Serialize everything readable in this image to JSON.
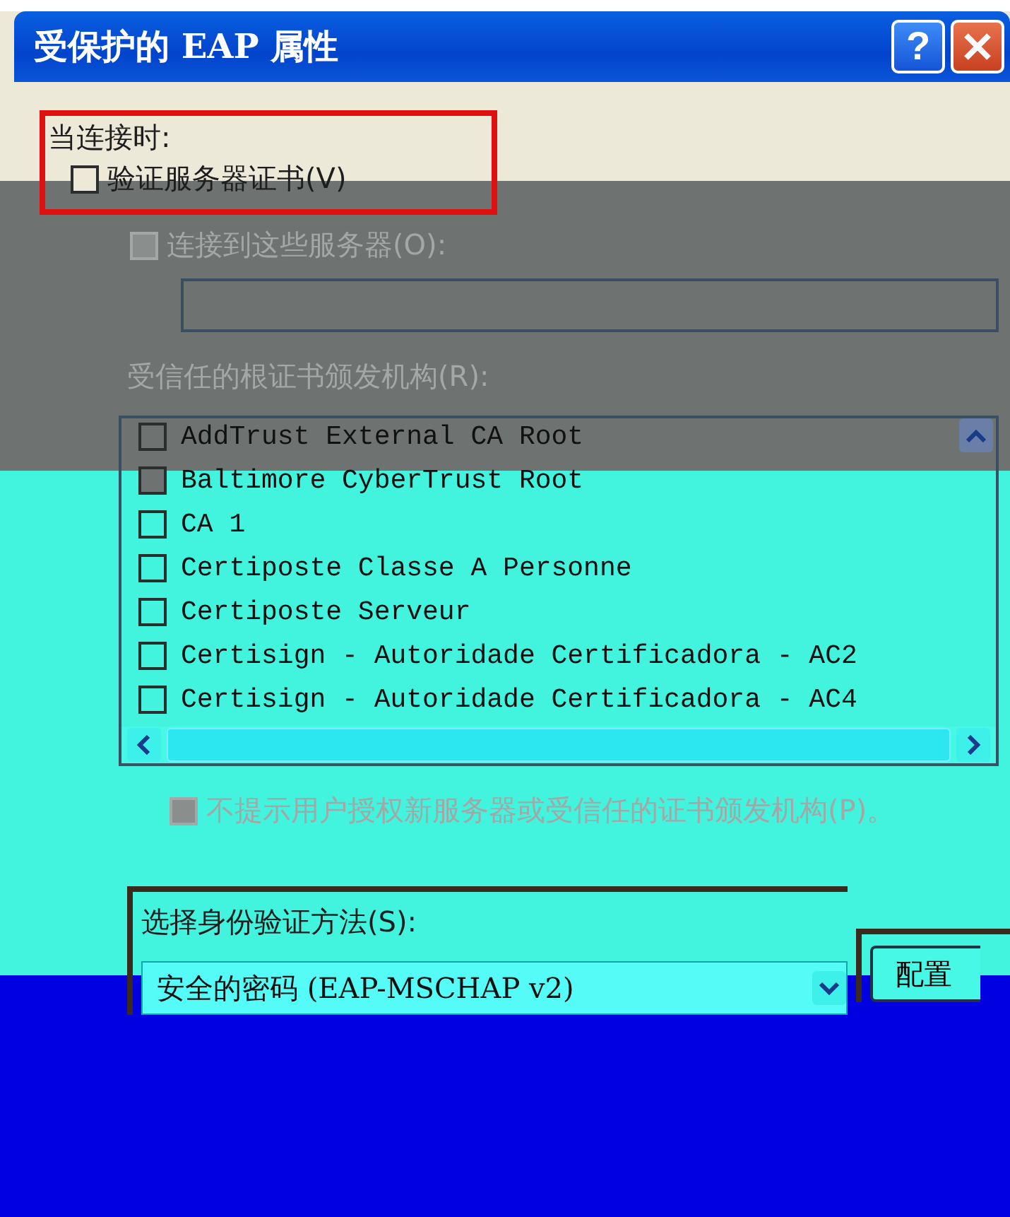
{
  "window": {
    "title": "受保护的 EAP 属性",
    "help_button": "?"
  },
  "section_label": "当连接时:",
  "validate_cert": {
    "label": "验证服务器证书(V)",
    "checked": false
  },
  "connect_servers": {
    "label": "连接到这些服务器(O):",
    "checked": false,
    "disabled": true
  },
  "trusted_ca": {
    "label": "受信任的根证书颁发机构(R):",
    "items": [
      {
        "name": "AddTrust External CA Root",
        "checked": false
      },
      {
        "name": "Baltimore CyberTrust Root",
        "checked": false
      },
      {
        "name": "CA 1",
        "checked": false
      },
      {
        "name": "Certiposte Classe A Personne",
        "checked": false
      },
      {
        "name": "Certiposte Serveur",
        "checked": false
      },
      {
        "name": "Certisign - Autoridade Certificadora - AC2",
        "checked": false
      },
      {
        "name": "Certisign - Autoridade Certificadora - AC4",
        "checked": false
      }
    ]
  },
  "no_prompt": {
    "label": "不提示用户授权新服务器或受信任的证书颁发机构(P)。",
    "checked": false,
    "disabled": true
  },
  "auth_method": {
    "label": "选择身份验证方法(S):",
    "value": "安全的密码 (EAP-MSCHAP v2)"
  },
  "configure_button": "配置"
}
